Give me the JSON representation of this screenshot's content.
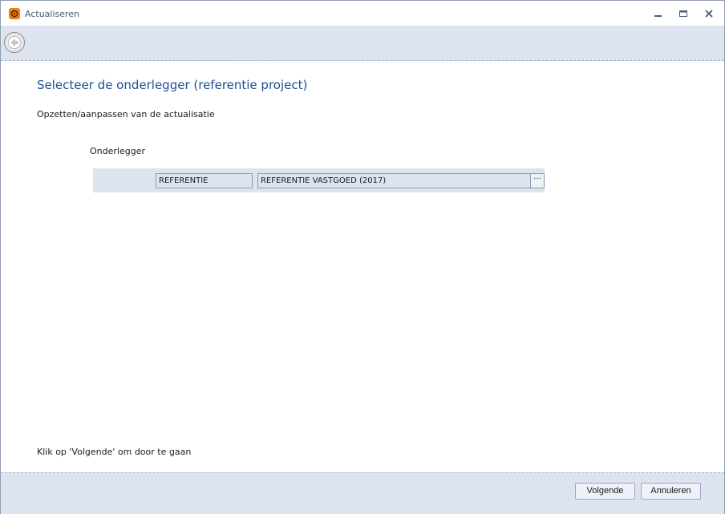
{
  "window": {
    "title": "Actualiseren",
    "app_icon": "gear-icon",
    "controls": [
      "minimize-icon",
      "maximize-icon",
      "close-icon"
    ]
  },
  "toolbar": {
    "back_icon": "back-arrow-icon"
  },
  "page": {
    "heading": "Selecteer de onderlegger (referentie project)",
    "subheading": "Opzetten/aanpassen van de actualisatie",
    "field_label": "Onderlegger",
    "code_value": "REFERENTIE",
    "name_value": "REFERENTIE VASTGOED (2017)",
    "browse_label": "···",
    "hint": "Klik op 'Volgende' om door te gaan"
  },
  "footer": {
    "next_label": "Volgende",
    "cancel_label": "Annuleren"
  },
  "colors": {
    "accent": "#1f4d94",
    "band": "#dde4f0",
    "app_icon": "#f07d1a"
  }
}
